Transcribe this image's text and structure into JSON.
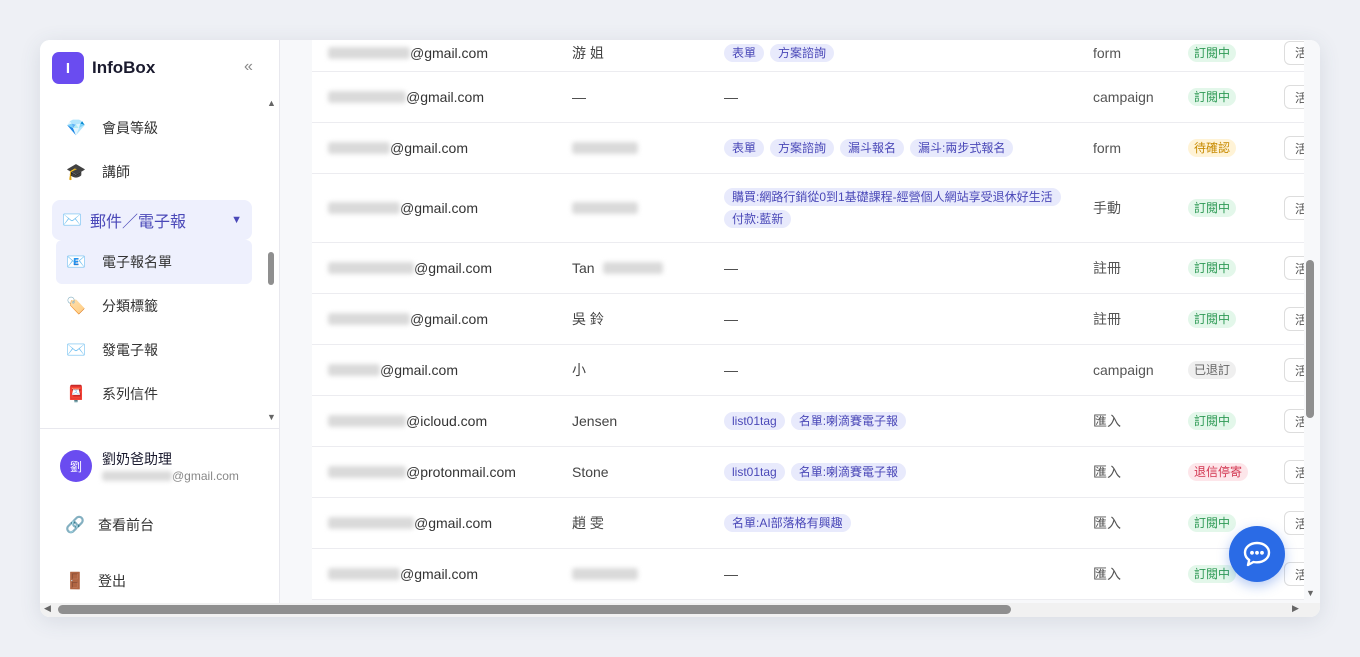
{
  "brand": {
    "logo_letter": "I",
    "name": "InfoBox",
    "collapse": "«"
  },
  "nav": {
    "items": [
      {
        "icon": "💎",
        "label": "會員等級"
      },
      {
        "icon": "🎓",
        "label": "講師"
      }
    ],
    "group": {
      "icon": "✉️",
      "label": "郵件／電子報",
      "caret": "▼"
    },
    "sub_items": [
      {
        "icon": "📧",
        "label": "電子報名單",
        "active": true
      },
      {
        "icon": "🏷️",
        "label": "分類標籤"
      },
      {
        "icon": "✉️",
        "label": "發電子報"
      },
      {
        "icon": "📮",
        "label": "系列信件"
      }
    ],
    "scroll_up": "▲",
    "scroll_down": "▼"
  },
  "user": {
    "avatar": "劉",
    "name": "劉奶爸助理",
    "email_domain": "@gmail.com"
  },
  "footer": [
    {
      "icon": "🔗",
      "label": "查看前台"
    },
    {
      "icon": "🚪",
      "label": "登出"
    }
  ],
  "colors": {
    "accent": "#6a4cf0",
    "tag_bg": "#e8eafc",
    "tag_fg": "#4a48b8",
    "status_subscribed_bg": "#e3f7ea",
    "status_subscribed_fg": "#2e9a55",
    "status_pending_bg": "#fff3d6",
    "status_pending_fg": "#c78a00",
    "status_unsub_bg": "#efefef",
    "status_unsub_fg": "#666666",
    "status_bounced_bg": "#fde6ea",
    "status_bounced_fg": "#d2344f",
    "chat_fab": "#2a6be6"
  },
  "table": {
    "rows": [
      {
        "email_domain": "@gmail.com",
        "name": "游 姐",
        "tags": [
          "表單",
          "方案諮詢"
        ],
        "source": "form",
        "status": "訂閱中",
        "status_kind": "subscribed",
        "action": "活"
      },
      {
        "email_domain": "@gmail.com",
        "name": "—",
        "tags": [],
        "tags_empty": "—",
        "source": "campaign",
        "status": "訂閱中",
        "status_kind": "subscribed",
        "action": "活"
      },
      {
        "email_domain": "@gmail.com",
        "name": "",
        "tags": [
          "表單",
          "方案諮詢",
          "漏斗報名",
          "漏斗:兩步式報名"
        ],
        "source": "form",
        "status": "待確認",
        "status_kind": "pending",
        "action": "活"
      },
      {
        "email_domain": "@gmail.com",
        "name": "",
        "tags": [
          "購買:網路行銷從0到1基礎課程-經營個人網站享受退休好生活",
          "付款:藍新"
        ],
        "source": "手動",
        "status": "訂閱中",
        "status_kind": "subscribed",
        "action": "活"
      },
      {
        "email_domain": "@gmail.com",
        "name": "Tan",
        "tags": [],
        "tags_empty": "—",
        "source": "註冊",
        "status": "訂閱中",
        "status_kind": "subscribed",
        "action": "活"
      },
      {
        "email_domain": "@gmail.com",
        "name": "吳 鈴",
        "tags": [],
        "tags_empty": "—",
        "source": "註冊",
        "status": "訂閱中",
        "status_kind": "subscribed",
        "action": "活"
      },
      {
        "email_domain": "@gmail.com",
        "name": "小",
        "tags": [],
        "tags_empty": "—",
        "source": "campaign",
        "status": "已退訂",
        "status_kind": "unsub",
        "action": "活"
      },
      {
        "email_domain": "@icloud.com",
        "name": "Jensen",
        "tags": [
          "list01tag",
          "名單:喇滴賽電子報"
        ],
        "source": "匯入",
        "status": "訂閱中",
        "status_kind": "subscribed",
        "action": "活"
      },
      {
        "email_domain": "@protonmail.com",
        "name": "Stone",
        "tags": [
          "list01tag",
          "名單:喇滴賽電子報"
        ],
        "source": "匯入",
        "status": "退信停寄",
        "status_kind": "bounced",
        "action": "活"
      },
      {
        "email_domain": "@gmail.com",
        "name": "趙 雯",
        "tags": [
          "名單:AI部落格有興趣"
        ],
        "source": "匯入",
        "status": "訂閱中",
        "status_kind": "subscribed",
        "action": "活"
      },
      {
        "email_domain": "@gmail.com",
        "name": "",
        "tags": [],
        "tags_empty": "—",
        "source": "匯入",
        "status": "訂閱中",
        "status_kind": "subscribed",
        "action": "活"
      }
    ]
  },
  "chat": {
    "icon": "chat-bubble-icon"
  }
}
